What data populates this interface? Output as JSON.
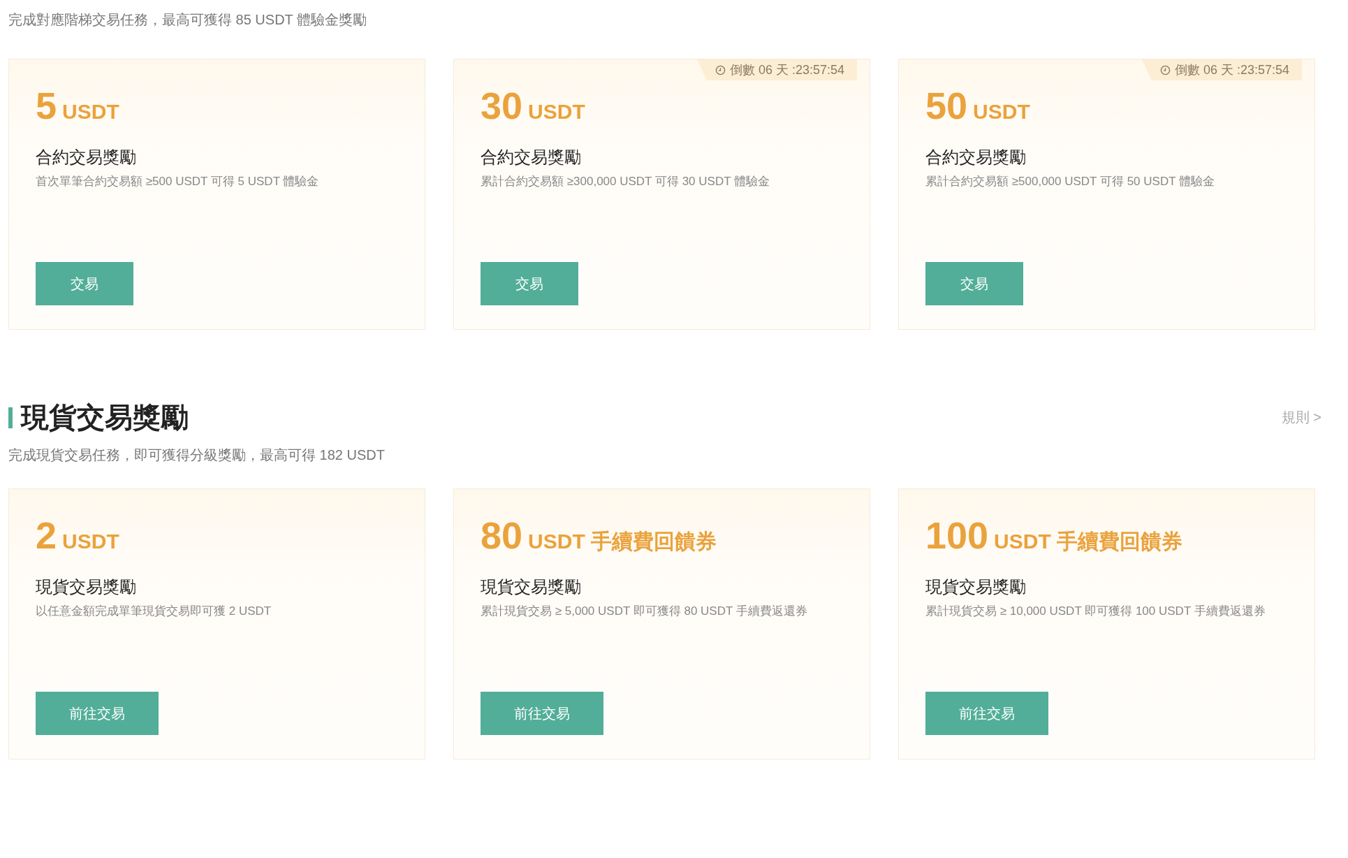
{
  "futures_section": {
    "subtitle": "完成對應階梯交易任務，最高可獲得 85 USDT 體驗金獎勵",
    "cards": [
      {
        "amount": "5",
        "unit": "USDT",
        "title": "合約交易獎勵",
        "description": "首次單筆合約交易額 ≥500 USDT 可得 5 USDT 體驗金",
        "button": "交易"
      },
      {
        "amount": "30",
        "unit": "USDT",
        "title": "合約交易獎勵",
        "description": "累計合約交易額 ≥300,000 USDT 可得 30 USDT 體驗金",
        "button": "交易",
        "countdown": "倒數 06 天 :23:57:54"
      },
      {
        "amount": "50",
        "unit": "USDT",
        "title": "合約交易獎勵",
        "description": "累計合約交易額 ≥500,000 USDT 可得 50 USDT 體驗金",
        "button": "交易",
        "countdown": "倒數 06 天 :23:57:54"
      }
    ]
  },
  "spot_section": {
    "heading": "現貨交易獎勵",
    "rules_link": "規則 >",
    "subtitle": "完成現貨交易任務，即可獲得分級獎勵，最高可得 182 USDT",
    "cards": [
      {
        "amount": "2",
        "unit": "USDT",
        "title": "現貨交易獎勵",
        "description": "以任意金額完成單筆現貨交易即可獲 2 USDT",
        "button": "前往交易"
      },
      {
        "amount": "80",
        "unit": "USDT 手續費回饋券",
        "title": "現貨交易獎勵",
        "description": "累計現貨交易 ≥ 5,000 USDT 即可獲得 80 USDT 手續費返還券",
        "button": "前往交易"
      },
      {
        "amount": "100",
        "unit": "USDT 手續費回饋券",
        "title": "現貨交易獎勵",
        "description": "累計現貨交易 ≥ 10,000 USDT 即可獲得 100 USDT 手續費返還券",
        "button": "前往交易"
      }
    ]
  }
}
